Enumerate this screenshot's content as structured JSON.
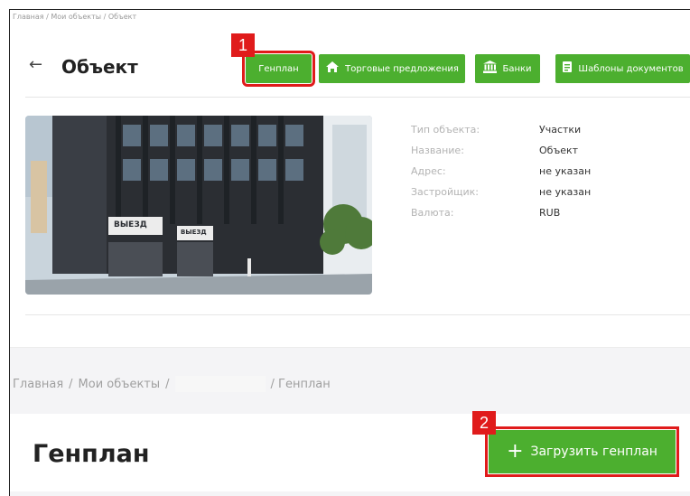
{
  "top": {
    "breadcrumb": "Главная / Мои объекты / Объект",
    "back_icon": "←",
    "title": "Объект",
    "buttons": {
      "genplan": "Генплан",
      "trade": "Торговые предложения",
      "banks": "Банки",
      "templates": "Шаблоны документов"
    },
    "properties": [
      {
        "label": "Тип объекта:",
        "value": "Участки"
      },
      {
        "label": "Название:",
        "value": "Объект"
      },
      {
        "label": "Адрес:",
        "value": "не указан"
      },
      {
        "label": "Застройщик:",
        "value": "не указан"
      },
      {
        "label": "Валюта:",
        "value": "RUB"
      }
    ],
    "photo_signs": [
      "ВЫЕЗД",
      "ВЫЕЗД"
    ]
  },
  "annotations": {
    "badge1": "1",
    "badge2": "2"
  },
  "bottom": {
    "crumb_home": "Главная",
    "crumb_sep1": "/",
    "crumb_objects": "Мои объекты",
    "crumb_sep2": "/",
    "crumb_current": "/ Генплан",
    "title": "Генплан",
    "upload_plus": "+",
    "upload_label": "Загрузить генплан"
  },
  "colors": {
    "accent": "#4caf2f",
    "highlight": "#e01b1b"
  }
}
